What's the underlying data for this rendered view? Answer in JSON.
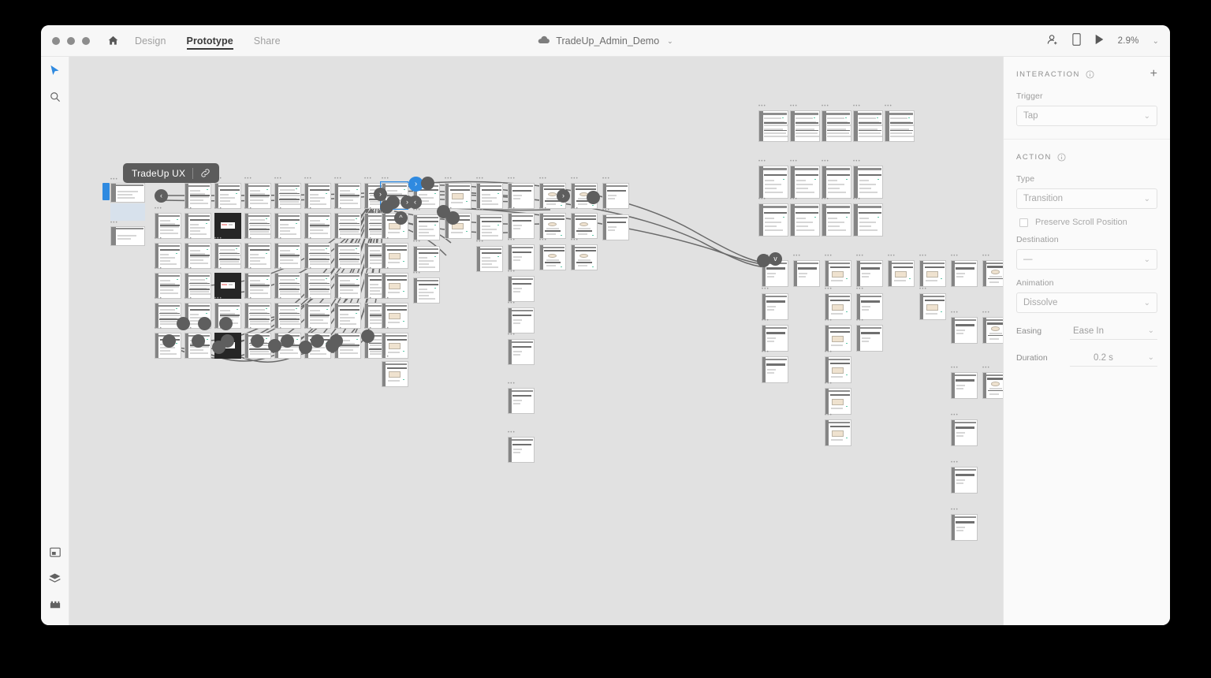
{
  "window": {
    "traffic_lights": [
      "close",
      "minimize",
      "maximize"
    ],
    "home_icon": "home-icon"
  },
  "tabs": [
    {
      "label": "Design",
      "active": false
    },
    {
      "label": "Prototype",
      "active": true
    },
    {
      "label": "Share",
      "active": false
    }
  ],
  "document": {
    "cloud_icon": "cloud-icon",
    "title": "TradeUp_Admin_Demo",
    "chevron": "⌄"
  },
  "title_right": {
    "invite_icon": "invite-user-icon",
    "device_icon": "device-preview-icon",
    "play_icon": "play-preview-icon",
    "zoom_level": "2.9%",
    "zoom_chevron": "⌄"
  },
  "tool_rail": {
    "top": [
      {
        "name": "select-tool",
        "icon": "cursor-icon",
        "selected": true
      },
      {
        "name": "zoom-tool",
        "icon": "magnifier-icon",
        "selected": false
      }
    ],
    "bottom": [
      {
        "name": "assets-panel-toggle",
        "icon": "asset-panel-icon"
      },
      {
        "name": "layers-panel-toggle",
        "icon": "layers-icon"
      },
      {
        "name": "plugins-panel-toggle",
        "icon": "plugins-icon"
      }
    ]
  },
  "flow_pill": {
    "name": "TradeUp UX",
    "link_icon": "link-icon"
  },
  "inspector": {
    "interaction": {
      "title": "INTERACTION",
      "info_icon": "info-icon",
      "add_label": "+",
      "trigger_label": "Trigger",
      "trigger_value": "Tap"
    },
    "action": {
      "title": "ACTION",
      "info_icon": "info-icon",
      "type_label": "Type",
      "type_value": "Transition",
      "preserve_scroll_label": "Preserve Scroll Position",
      "preserve_scroll_checked": false,
      "destination_label": "Destination",
      "destination_value": "—",
      "animation_label": "Animation",
      "animation_value": "Dissolve",
      "easing_label": "Easing",
      "easing_value": "Ease In",
      "duration_label": "Duration",
      "duration_value": "0.2 s"
    }
  },
  "colors": {
    "accent": "#2f8ae0",
    "canvas_bg": "#e1e1e1",
    "chrome_bg": "#f7f7f7",
    "panel_bg": "#fafafa",
    "hotspot": "#5e5e5e",
    "pill_bg": "#5b5b5b"
  },
  "canvas": {
    "artboard_count_note": "prototype screen thumbnails at 2.9% zoom",
    "label_dots": "•••"
  }
}
